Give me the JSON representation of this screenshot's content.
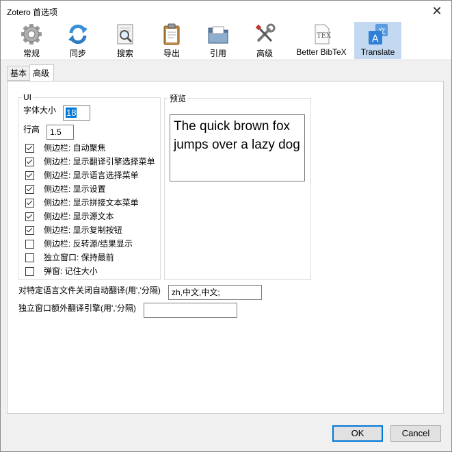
{
  "window": {
    "title": "Zotero 首选项",
    "close_glyph": "✕"
  },
  "toolbar": {
    "items": [
      {
        "label": "常规",
        "icon": "gear-icon"
      },
      {
        "label": "同步",
        "icon": "sync-icon"
      },
      {
        "label": "搜索",
        "icon": "search-icon"
      },
      {
        "label": "导出",
        "icon": "clipboard-icon"
      },
      {
        "label": "引用",
        "icon": "folder-icon"
      },
      {
        "label": "高级",
        "icon": "tools-icon"
      },
      {
        "label": "Better BibTeX",
        "icon": "tex-icon"
      },
      {
        "label": "Translate",
        "icon": "translate-icon"
      }
    ],
    "selected": "Translate"
  },
  "tabs": [
    {
      "label": "基本"
    },
    {
      "label": "高级"
    }
  ],
  "ui_group": {
    "legend": "UI",
    "font_size_label": "字体大小",
    "font_size_value": "18",
    "line_height_label": "行高",
    "line_height_value": "1.5",
    "checkboxes": [
      {
        "label": "侧边栏: 自动聚焦",
        "checked": true
      },
      {
        "label": "侧边栏: 显示翻译引擎选择菜单",
        "checked": true
      },
      {
        "label": "侧边栏: 显示语言选择菜单",
        "checked": true
      },
      {
        "label": "侧边栏: 显示设置",
        "checked": true
      },
      {
        "label": "侧边栏: 显示拼接文本菜单",
        "checked": true
      },
      {
        "label": "侧边栏: 显示源文本",
        "checked": true
      },
      {
        "label": "侧边栏: 显示复制按钮",
        "checked": true
      },
      {
        "label": "侧边栏: 反转源/结果显示",
        "checked": false
      },
      {
        "label": "独立窗口: 保持最前",
        "checked": false
      },
      {
        "label": "弹窗: 记住大小",
        "checked": false
      }
    ]
  },
  "preview_group": {
    "legend": "预览",
    "text": "The quick brown fox jumps over a lazy dog"
  },
  "disable_auto_translate": {
    "label": "对特定语言文件关闭自动翻译(用','分隔)",
    "value": "zh,中文,中文;"
  },
  "extra_engines": {
    "label": "独立窗口额外翻译引擎(用','分隔)",
    "value": ""
  },
  "buttons": {
    "ok": "OK",
    "cancel": "Cancel"
  },
  "colors": {
    "selected_toolbar_bg": "#c3d9f2",
    "accent": "#0078d7"
  }
}
